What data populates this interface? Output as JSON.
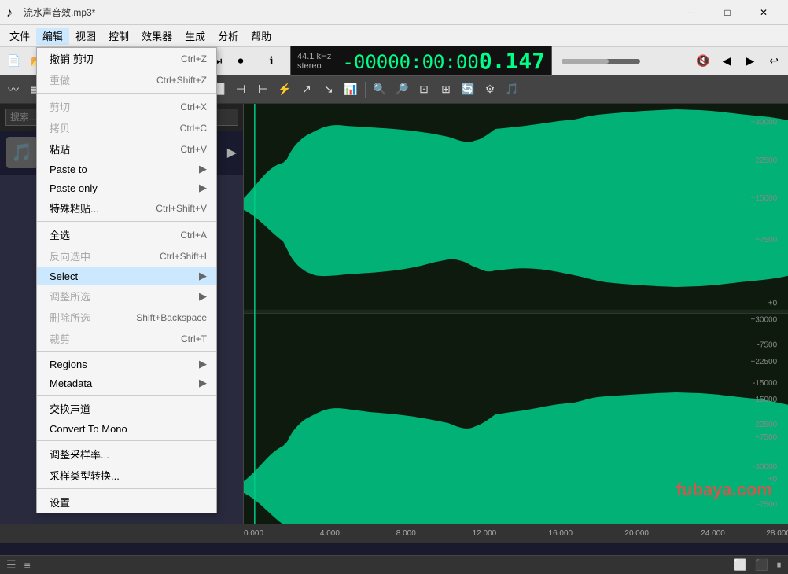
{
  "titlebar": {
    "title": "流水声音效.mp3*",
    "icon": "♪",
    "minimize": "─",
    "maximize": "□",
    "close": "✕"
  },
  "menubar": {
    "items": [
      "文件",
      "编辑",
      "视图",
      "控制",
      "效果器",
      "生成",
      "分析",
      "帮助"
    ]
  },
  "transport": {
    "sample_rate": "44.1 kHz",
    "channels": "stereo",
    "time": "-00000:00:00.147",
    "short_time": "0.147"
  },
  "menu_edit": {
    "items": [
      {
        "label": "撤销 剪切",
        "shortcut": "Ctrl+Z",
        "enabled": true,
        "has_submenu": false
      },
      {
        "label": "重做",
        "shortcut": "Ctrl+Shift+Z",
        "enabled": false,
        "has_submenu": false
      },
      {
        "separator": true
      },
      {
        "label": "剪切",
        "shortcut": "Ctrl+X",
        "enabled": false,
        "has_submenu": false
      },
      {
        "label": "拷贝",
        "shortcut": "Ctrl+C",
        "enabled": false,
        "has_submenu": false
      },
      {
        "label": "粘贴",
        "shortcut": "Ctrl+V",
        "enabled": true,
        "has_submenu": false
      },
      {
        "label": "Paste to",
        "shortcut": "",
        "enabled": true,
        "has_submenu": true
      },
      {
        "label": "Paste only",
        "shortcut": "",
        "enabled": true,
        "has_submenu": true
      },
      {
        "label": "特殊粘贴...",
        "shortcut": "Ctrl+Shift+V",
        "enabled": true,
        "has_submenu": false
      },
      {
        "separator": true
      },
      {
        "label": "全选",
        "shortcut": "Ctrl+A",
        "enabled": true,
        "has_submenu": false
      },
      {
        "label": "反向选中",
        "shortcut": "Ctrl+Shift+I",
        "enabled": false,
        "has_submenu": false
      },
      {
        "label": "Select",
        "shortcut": "",
        "enabled": true,
        "has_submenu": true
      },
      {
        "label": "调整所选",
        "shortcut": "",
        "enabled": false,
        "has_submenu": true
      },
      {
        "label": "删除所选",
        "shortcut": "Shift+Backspace",
        "enabled": false,
        "has_submenu": false
      },
      {
        "label": "裁剪",
        "shortcut": "Ctrl+T",
        "enabled": false,
        "has_submenu": false
      },
      {
        "separator": true
      },
      {
        "label": "Regions",
        "shortcut": "",
        "enabled": true,
        "has_submenu": true
      },
      {
        "label": "Metadata",
        "shortcut": "",
        "enabled": true,
        "has_submenu": true
      },
      {
        "separator": true
      },
      {
        "label": "交换声道",
        "shortcut": "",
        "enabled": true,
        "has_submenu": false
      },
      {
        "label": "Convert To Mono",
        "shortcut": "",
        "enabled": true,
        "has_submenu": false
      },
      {
        "separator": true
      },
      {
        "label": "调整采样率...",
        "shortcut": "",
        "enabled": true,
        "has_submenu": false
      },
      {
        "label": "采样类型转换...",
        "shortcut": "",
        "enabled": true,
        "has_submenu": false
      },
      {
        "separator": true
      },
      {
        "label": "设置",
        "shortcut": "",
        "enabled": true,
        "has_submenu": false
      }
    ]
  },
  "y_axis": {
    "top_labels": [
      "+30000",
      "+22500",
      "+15000",
      "+7500",
      "+0",
      "-7500",
      "-15000",
      "-22500",
      "-30000"
    ],
    "bottom_labels": [
      "+30000",
      "+22500",
      "+15000",
      "+7500",
      "+0",
      "-7500",
      "-15000",
      "-22500",
      "-30000"
    ]
  },
  "timeline": {
    "labels": [
      "0.000",
      "4.000",
      "8.000",
      "12.000",
      "16.000",
      "20.000",
      "24.000",
      "28.000"
    ]
  },
  "watermark": "fubaya.com"
}
